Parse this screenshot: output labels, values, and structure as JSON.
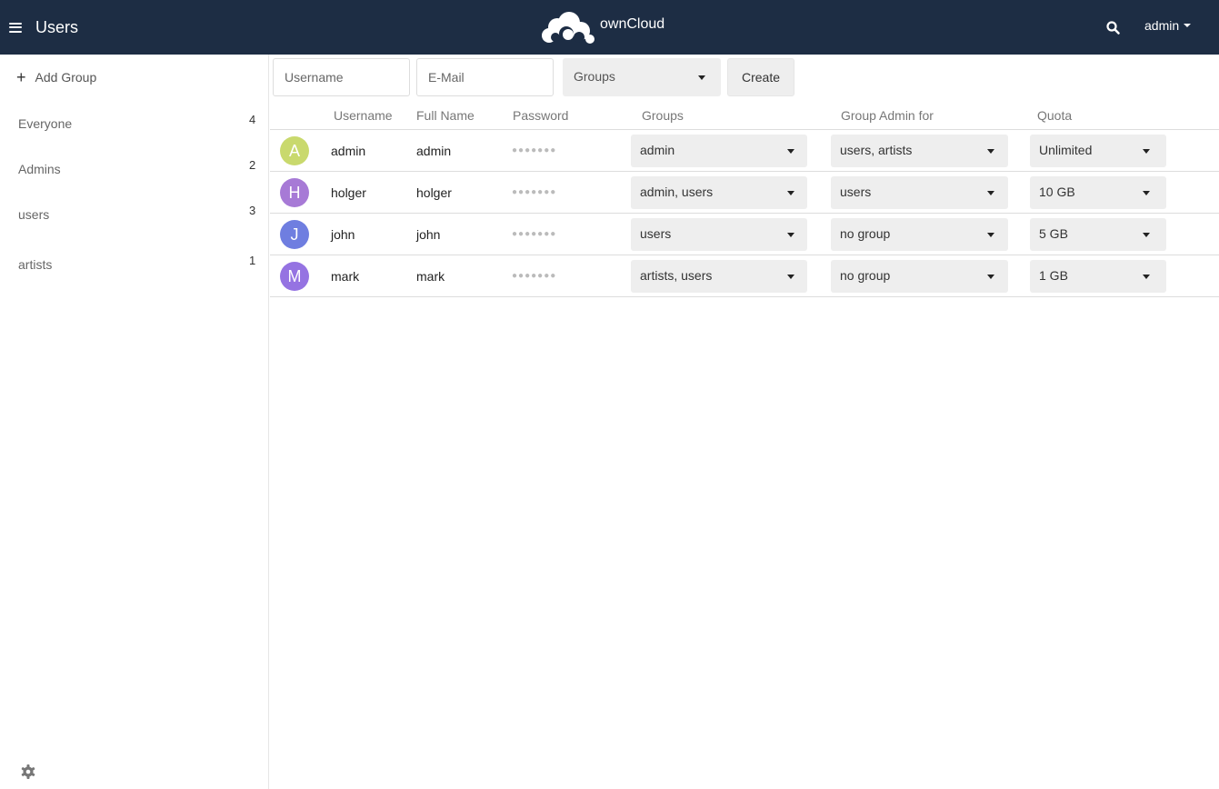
{
  "header": {
    "app_title": "Users",
    "logo_text": "ownCloud",
    "user_name": "admin"
  },
  "sidebar": {
    "add_group_label": "Add Group",
    "groups": [
      {
        "name": "Everyone",
        "count": "4"
      },
      {
        "name": "Admins",
        "count": "2"
      },
      {
        "name": "users",
        "count": "3"
      },
      {
        "name": "artists",
        "count": "1"
      }
    ]
  },
  "create_form": {
    "username_placeholder": "Username",
    "email_placeholder": "E-Mail",
    "groups_label": "Groups",
    "create_label": "Create"
  },
  "table": {
    "columns": [
      "Username",
      "Full Name",
      "Password",
      "Groups",
      "Group Admin for",
      "Quota"
    ],
    "rows": [
      {
        "initial": "A",
        "avatar_color": "#c9d96d",
        "username": "admin",
        "full_name": "admin",
        "password": "●●●●●●●",
        "groups": "admin",
        "group_admin": "users, artists",
        "quota": "Unlimited"
      },
      {
        "initial": "H",
        "avatar_color": "#a77ad6",
        "username": "holger",
        "full_name": "holger",
        "password": "●●●●●●●",
        "groups": "admin, users",
        "group_admin": "users",
        "quota": "10 GB"
      },
      {
        "initial": "J",
        "avatar_color": "#6f7ee0",
        "username": "john",
        "full_name": "john",
        "password": "●●●●●●●",
        "groups": "users",
        "group_admin": "no group",
        "quota": "5 GB"
      },
      {
        "initial": "M",
        "avatar_color": "#9573e2",
        "username": "mark",
        "full_name": "mark",
        "password": "●●●●●●●",
        "groups": "artists, users",
        "group_admin": "no group",
        "quota": "1 GB"
      }
    ]
  },
  "colors": {
    "header_bg": "#1d2d44"
  }
}
